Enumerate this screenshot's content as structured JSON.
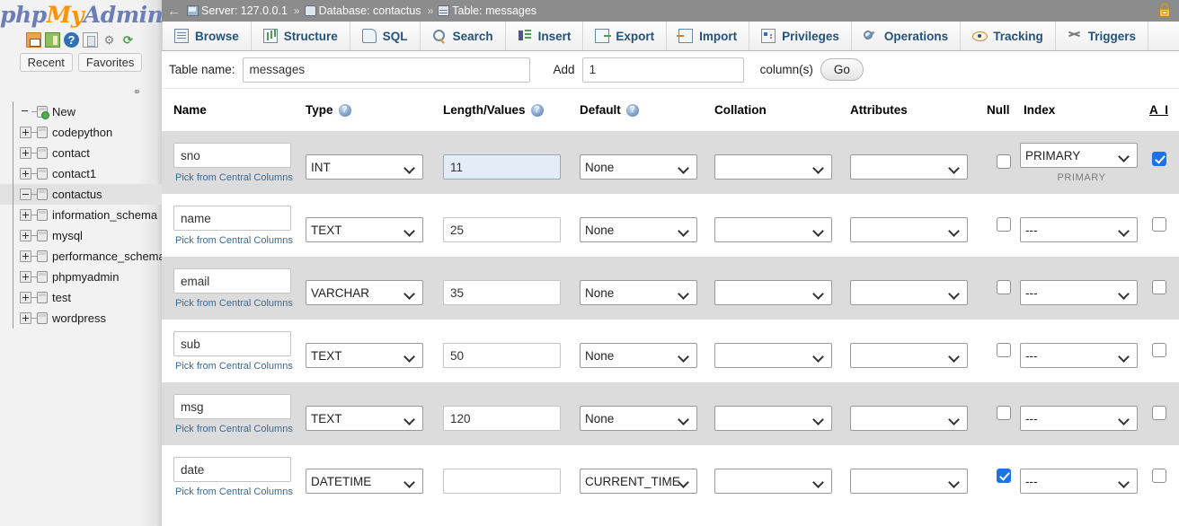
{
  "app": {
    "logo_php": "php",
    "logo_my": "My",
    "logo_admin": "Admin"
  },
  "sidebar": {
    "icons": [
      {
        "name": "home-icon",
        "glyph": ""
      },
      {
        "name": "logout-icon",
        "glyph": ""
      },
      {
        "name": "help-icon",
        "glyph": "?"
      },
      {
        "name": "documentation-icon",
        "glyph": ""
      },
      {
        "name": "settings-gear-icon",
        "glyph": "⚙"
      },
      {
        "name": "reload-icon",
        "glyph": "⟳"
      }
    ],
    "recent_label": "Recent",
    "favorites_label": "Favorites",
    "tree": [
      {
        "label": "New",
        "toggle": "none",
        "selected": false
      },
      {
        "label": "codepython",
        "toggle": "plus",
        "selected": false
      },
      {
        "label": "contact",
        "toggle": "plus",
        "selected": false
      },
      {
        "label": "contact1",
        "toggle": "plus",
        "selected": false
      },
      {
        "label": "contactus",
        "toggle": "minus",
        "selected": true
      },
      {
        "label": "information_schema",
        "toggle": "plus",
        "selected": false
      },
      {
        "label": "mysql",
        "toggle": "plus",
        "selected": false
      },
      {
        "label": "performance_schema",
        "toggle": "plus",
        "selected": false
      },
      {
        "label": "phpmyadmin",
        "toggle": "plus",
        "selected": false
      },
      {
        "label": "test",
        "toggle": "plus",
        "selected": false
      },
      {
        "label": "wordpress",
        "toggle": "plus",
        "selected": false
      }
    ]
  },
  "breadcrumb": {
    "back_glyph": "←",
    "server": "Server: 127.0.0.1",
    "database": "Database: contactus",
    "table": "Table: messages",
    "separator": "»",
    "lock_icon": "lock-icon"
  },
  "tabs": [
    {
      "label": "Browse",
      "icon": "browse-icon"
    },
    {
      "label": "Structure",
      "icon": "structure-icon"
    },
    {
      "label": "SQL",
      "icon": "sql-icon"
    },
    {
      "label": "Search",
      "icon": "search-icon"
    },
    {
      "label": "Insert",
      "icon": "insert-icon"
    },
    {
      "label": "Export",
      "icon": "export-icon"
    },
    {
      "label": "Import",
      "icon": "import-icon"
    },
    {
      "label": "Privileges",
      "icon": "privileges-icon"
    },
    {
      "label": "Operations",
      "icon": "operations-icon"
    },
    {
      "label": "Tracking",
      "icon": "tracking-icon"
    },
    {
      "label": "Triggers",
      "icon": "triggers-icon"
    }
  ],
  "table_bar": {
    "table_name_label": "Table name:",
    "table_name_value": "messages",
    "add_label": "Add",
    "add_value": "1",
    "columns_label": "column(s)",
    "go_label": "Go"
  },
  "grid": {
    "headers": {
      "name": "Name",
      "type": "Type",
      "length": "Length/Values",
      "default": "Default",
      "collation": "Collation",
      "attributes": "Attributes",
      "null": "Null",
      "index": "Index",
      "auto_increment": "A_I"
    },
    "pick_link": "Pick from Central Columns",
    "rows": [
      {
        "name": "sno",
        "type": "INT",
        "length": "11",
        "length_focused": true,
        "default": "None",
        "collation": "",
        "attributes": "",
        "null": false,
        "index": "PRIMARY",
        "index_note": "PRIMARY",
        "auto_increment": true
      },
      {
        "name": "name",
        "type": "TEXT",
        "length": "25",
        "length_focused": false,
        "default": "None",
        "collation": "",
        "attributes": "",
        "null": false,
        "index": "---",
        "index_note": "",
        "auto_increment": false
      },
      {
        "name": "email",
        "type": "VARCHAR",
        "length": "35",
        "length_focused": false,
        "default": "None",
        "collation": "",
        "attributes": "",
        "null": false,
        "index": "---",
        "index_note": "",
        "auto_increment": false
      },
      {
        "name": "sub",
        "type": "TEXT",
        "length": "50",
        "length_focused": false,
        "default": "None",
        "collation": "",
        "attributes": "",
        "null": false,
        "index": "---",
        "index_note": "",
        "auto_increment": false
      },
      {
        "name": "msg",
        "type": "TEXT",
        "length": "120",
        "length_focused": false,
        "default": "None",
        "collation": "",
        "attributes": "",
        "null": false,
        "index": "---",
        "index_note": "",
        "auto_increment": false
      },
      {
        "name": "date",
        "type": "DATETIME",
        "length": "",
        "length_focused": false,
        "default": "CURRENT_TIME",
        "collation": "",
        "attributes": "",
        "null": true,
        "index": "---",
        "index_note": "",
        "auto_increment": false
      }
    ]
  },
  "colors": {
    "breadcrumb_bg": "#8c8c8c",
    "tab_text": "#23527c",
    "logo_blue": "#6c7eb7",
    "logo_orange": "#f89406",
    "checkbox_checked": "#1a73e8",
    "row_odd_bg": "#dcdcdc",
    "focused_input_bg": "#e3ecf7"
  }
}
